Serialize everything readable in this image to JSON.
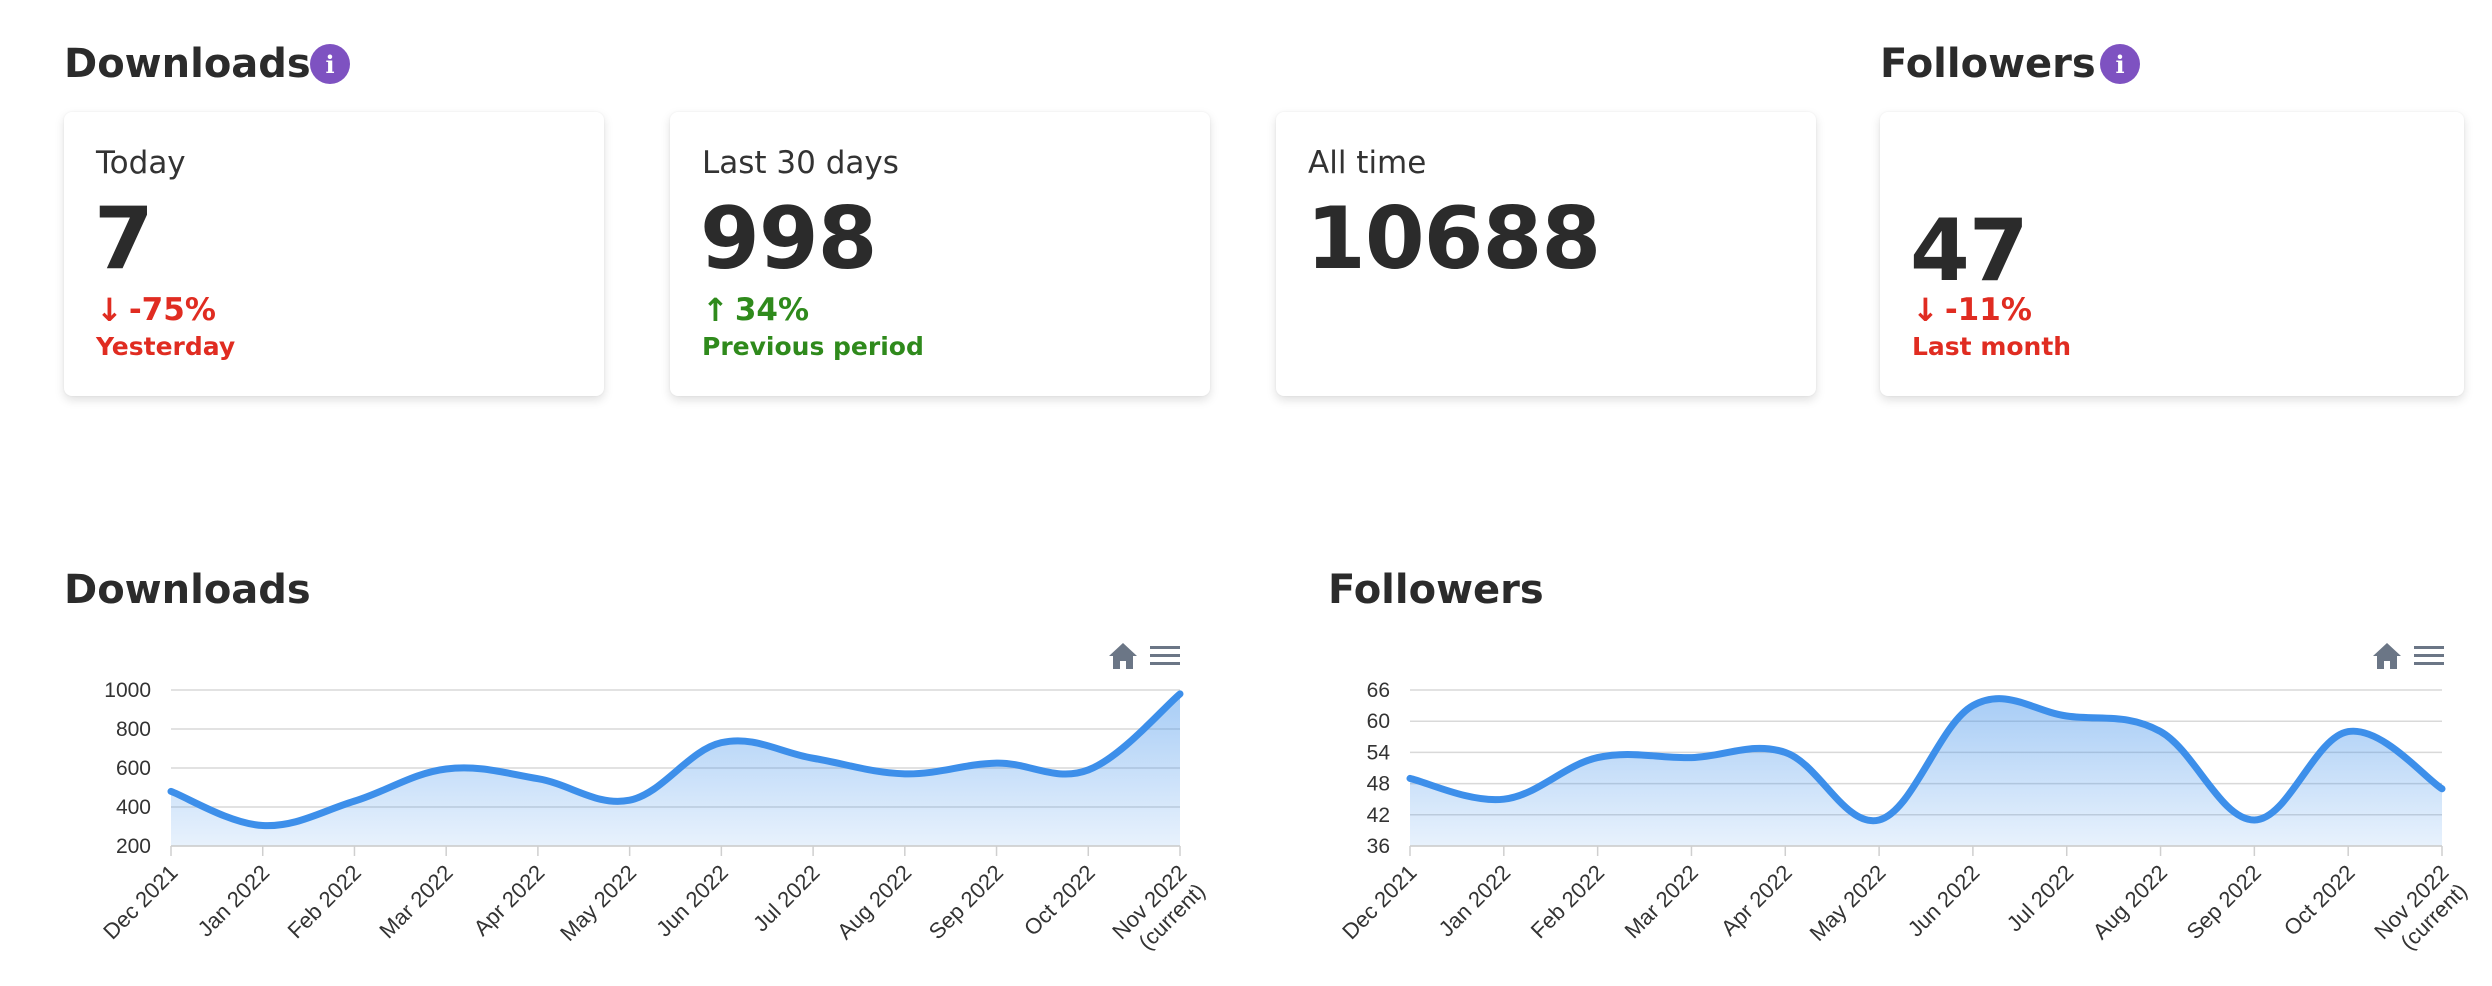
{
  "downloads_section": {
    "title": "Downloads",
    "cards": [
      {
        "label": "Today",
        "value": "7",
        "delta": "-75%",
        "delta_direction": "down",
        "delta_label": "Yesterday"
      },
      {
        "label": "Last 30 days",
        "value": "998",
        "delta": "34%",
        "delta_direction": "up",
        "delta_label": "Previous period"
      },
      {
        "label": "All time",
        "value": "10688"
      }
    ]
  },
  "followers_section": {
    "title": "Followers",
    "card": {
      "label": "",
      "value": "47",
      "delta": "-11%",
      "delta_direction": "down",
      "delta_label": "Last month"
    }
  },
  "icons": {
    "info": "info-icon",
    "down_arrow": "↓",
    "up_arrow": "↑",
    "home": "home-icon",
    "menu": "menu-icon",
    "info_glyph": "i"
  },
  "colors": {
    "accent_purple": "#7e52c1",
    "negative": "#e02c21",
    "positive": "#2f8a1c",
    "series": "#3d8fea"
  },
  "chart_data": [
    {
      "type": "area",
      "title": "Downloads",
      "categories": [
        "Dec 2021",
        "Jan 2022",
        "Feb 2022",
        "Mar 2022",
        "Apr 2022",
        "May 2022",
        "Jun 2022",
        "Jul 2022",
        "Aug 2022",
        "Sep 2022",
        "Oct 2022",
        "Nov 2022 (current)"
      ],
      "values": [
        480,
        305,
        430,
        595,
        545,
        435,
        730,
        650,
        570,
        625,
        590,
        980
      ],
      "yticks": [
        200,
        400,
        600,
        800,
        1000
      ],
      "ylim": [
        200,
        1000
      ],
      "grid": true
    },
    {
      "type": "area",
      "title": "Followers",
      "categories": [
        "Dec 2021",
        "Jan 2022",
        "Feb 2022",
        "Mar 2022",
        "Apr 2022",
        "May 2022",
        "Jun 2022",
        "Jul 2022",
        "Aug 2022",
        "Sep 2022",
        "Oct 2022",
        "Nov 2022 (current)"
      ],
      "values": [
        49,
        45,
        53,
        53,
        54,
        41,
        63,
        61,
        58,
        41,
        58,
        47
      ],
      "yticks": [
        36,
        42,
        48,
        54,
        60,
        66
      ],
      "ylim": [
        36,
        66
      ],
      "grid": true
    }
  ]
}
